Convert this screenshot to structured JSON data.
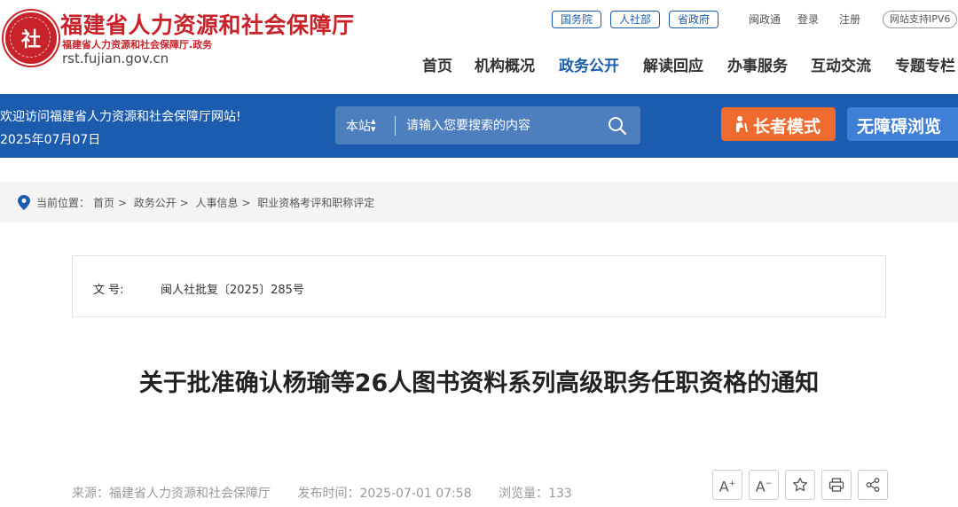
{
  "header": {
    "site_title": "福建省人力资源和社会保障厅",
    "site_subtitle": "福建省人力资源和社会保障厅.政务",
    "domain": "rst.fujian.gov.cn",
    "emblem_text": "社",
    "top_links": {
      "guowuyuan": "国务院",
      "renshebu": "人社部",
      "shengzhengfu": "省政府",
      "minnantong": "闽政通",
      "login": "登录",
      "register": "注册",
      "ipv6": "网站支持IPV6"
    },
    "nav": [
      "首页",
      "机构概况",
      "政务公开",
      "解读回应",
      "办事服务",
      "互动交流",
      "专题专栏"
    ],
    "active_nav": "政务公开"
  },
  "banner": {
    "welcome": "欢迎访问福建省人力资源和社会保障厅网站!",
    "date": "2025年07月07日",
    "search_scope": "本站",
    "search_placeholder": "请输入您要搜索的内容",
    "elder_mode": "长者模式",
    "accessible": "无障碍浏览"
  },
  "breadcrumb": {
    "prefix": "当前位置：",
    "items": [
      "首页",
      "政务公开",
      "人事信息",
      "职业资格考评和职称评定"
    ],
    "separator": ">"
  },
  "document": {
    "doc_no_label": "文 号:",
    "doc_no": "闽人社批复〔2025〕285号",
    "title": "关于批准确认杨瑜等26人图书资料系列高级职务任职资格的通知",
    "source": "来源：福建省人力资源和社会保障厅",
    "publish_time": "发布时间：2025-07-01 07:58",
    "views": "浏览量：133"
  },
  "tools": {
    "font_up": "A",
    "font_down": "A"
  },
  "colors": {
    "brand_red": "#c8222a",
    "brand_blue": "#1c5cae",
    "elder_orange": "#ee6a2f",
    "access_blue": "#3f7fd6"
  }
}
